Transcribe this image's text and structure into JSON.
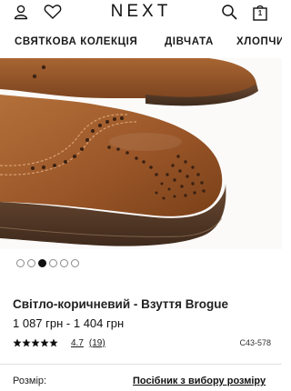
{
  "header": {
    "logo": "NEXT",
    "bag_count": "1",
    "icons": [
      "account-icon",
      "wishlist-icon",
      "search-icon",
      "bag-icon"
    ]
  },
  "nav": {
    "items": [
      "СВЯТКОВА КОЛЕКЦІЯ",
      "ДІВЧАТА",
      "ХЛОПЧИ"
    ]
  },
  "product": {
    "image_description": "brown-brogue-shoe-photo",
    "gallery": {
      "count": 6,
      "active_index": 2
    },
    "title": "Світло-коричневий - Взуття Brogue",
    "price": "1 087 грн - 1 404 грн",
    "rating": {
      "value": "4.7",
      "count": "(19)",
      "stars": 4.7
    },
    "code": "C43-578"
  },
  "size": {
    "label": "Розмір:",
    "guide_link": "Посібник з вибору розміру"
  },
  "colors": {
    "leather": "#a05c2c",
    "sole": "#5a3d2a",
    "text": "#1a1a1a"
  }
}
